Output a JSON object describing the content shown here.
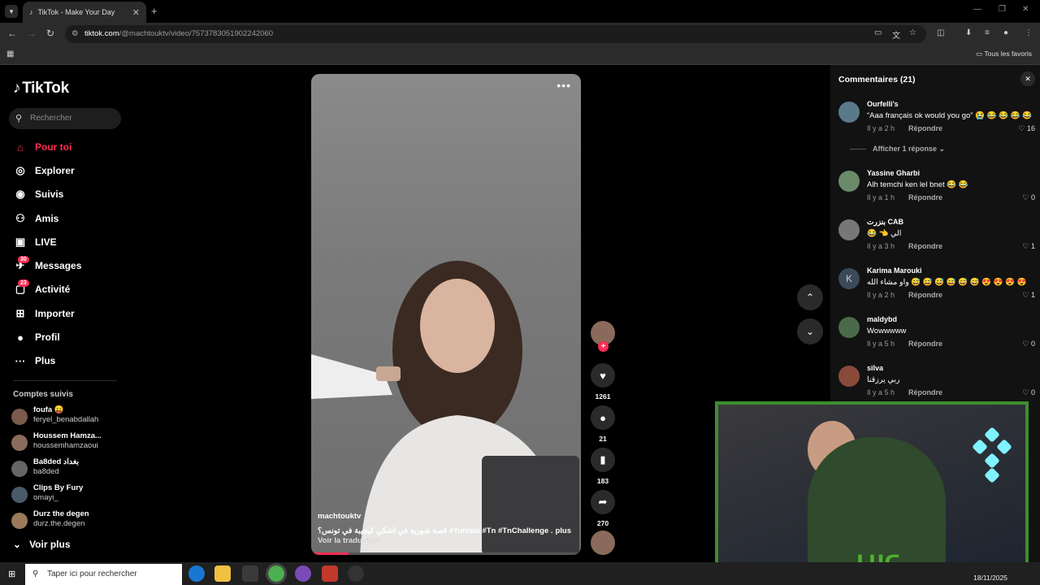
{
  "browser": {
    "tab_title": "TikTok - Make Your Day",
    "url_domain": "tiktok.com",
    "url_path": "/@machtouktv/video/7573783051902242060",
    "bookmarks_label": "Tous les favoris"
  },
  "sidebar": {
    "logo": "TikTok",
    "search_placeholder": "Rechercher",
    "items": [
      {
        "label": "Pour toi",
        "icon": "home-icon"
      },
      {
        "label": "Explorer",
        "icon": "compass-icon"
      },
      {
        "label": "Suivis",
        "icon": "following-avatar-icon"
      },
      {
        "label": "Amis",
        "icon": "friends-icon"
      },
      {
        "label": "LIVE",
        "icon": "live-icon"
      },
      {
        "label": "Messages",
        "icon": "messages-icon",
        "badge": "30"
      },
      {
        "label": "Activité",
        "icon": "activity-icon",
        "badge": "23"
      },
      {
        "label": "Importer",
        "icon": "upload-icon"
      },
      {
        "label": "Profil",
        "icon": "profile-icon"
      },
      {
        "label": "Plus",
        "icon": "more-icon"
      }
    ],
    "following_title": "Comptes suivis",
    "accounts": [
      {
        "name": "foufa 😛",
        "handle": "feryel_benabdallah"
      },
      {
        "name": "Houssem Hamza...",
        "handle": "houssemhamzaoui"
      },
      {
        "name": "Ba8ded بغداد",
        "handle": "ba8ded"
      },
      {
        "name": "Clips By Fury",
        "handle": "omayi_"
      },
      {
        "name": "Durz the degen",
        "handle": "durz.the.degen"
      }
    ],
    "see_more": "Voir plus"
  },
  "video": {
    "author": "machtouktv",
    "caption": "قصة شورية في أشكي كيجيبة في تونس؟ #Tunisia #Tn #TnChallenge ...",
    "more_label": "plus",
    "translate_label": "Voir la traduction",
    "progress": 0.14,
    "likes": "1261",
    "comments": "21",
    "saves": "183",
    "shares": "270"
  },
  "comments": {
    "title": "Commentaires (21)",
    "reply_label": "Répondre",
    "show_replies": "Afficher 1 réponse",
    "items": [
      {
        "user": "Ourfelli's",
        "text": "“Aaa français ok would you go” 😭 😂 😂 😂 😂",
        "time": "Il y a 2 h",
        "likes": "16"
      },
      {
        "user": "Yassine Gharbi",
        "text": "Alh temchi ken lel bnet 😂 😂",
        "time": "Il y a 1 h",
        "likes": "0"
      },
      {
        "user": "بنزرت CAB",
        "text": "😂 👈 الي",
        "time": "Il y a 3 h",
        "likes": "1"
      },
      {
        "user": "Karima Marouki",
        "text": "واو مشاء الله 😅 😅 😅 😅 😅 😅 😍 😍 😍 😍",
        "time": "Il y a 2 h",
        "likes": "1",
        "avatar_letter": "K"
      },
      {
        "user": "maldybd",
        "text": "Wowwwww",
        "time": "Il y a 5 h",
        "likes": "0"
      },
      {
        "user": "silva",
        "text": "ربي يرزقنا",
        "time": "Il y a 5 h",
        "likes": "0"
      }
    ]
  },
  "taskbar": {
    "search_placeholder": "Taper ici pour rechercher",
    "date": "18/11/2025"
  },
  "colors": {
    "accent": "#fe2c55",
    "webcam_frame": "#3e8e2e"
  }
}
